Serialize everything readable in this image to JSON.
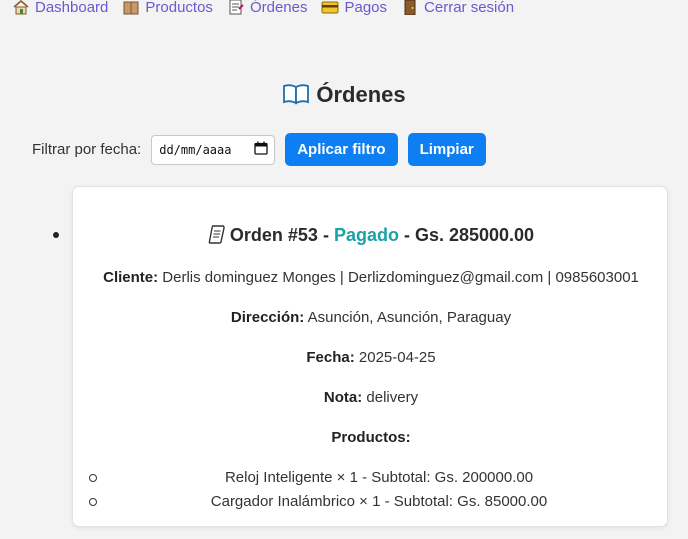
{
  "nav": {
    "items": [
      {
        "label": "Dashboard",
        "icon": "house-icon"
      },
      {
        "label": "Productos",
        "icon": "box-icon"
      },
      {
        "label": "Órdenes",
        "icon": "memo-icon"
      },
      {
        "label": "Pagos",
        "icon": "credit-card-icon"
      },
      {
        "label": "Cerrar sesión",
        "icon": "door-icon"
      }
    ]
  },
  "page": {
    "title": "Órdenes"
  },
  "filter": {
    "label": "Filtrar por fecha:",
    "date_placeholder": "dd/mm/aaaa",
    "apply_label": "Aplicar filtro",
    "clear_label": "Limpiar"
  },
  "order": {
    "prefix": "Orden #53 - ",
    "status": "Pagado",
    "total": " - Gs. 285000.00",
    "client_label": "Cliente:",
    "client_value": " Derlis dominguez Monges | Derlizdominguez@gmail.com | 0985603001",
    "address_label": "Dirección:",
    "address_value": " Asunción, Asunción, Paraguay",
    "date_label": "Fecha:",
    "date_value": " 2025-04-25",
    "note_label": "Nota:",
    "note_value": " delivery",
    "products_label": "Productos:",
    "products": [
      "Reloj Inteligente × 1 - Subtotal: Gs. 200000.00",
      "Cargador Inalámbrico × 1 - Subtotal: Gs. 85000.00"
    ]
  },
  "colors": {
    "link": "#6a5acd",
    "button": "#0d7ff2",
    "status_paid": "#1ba1a8"
  }
}
